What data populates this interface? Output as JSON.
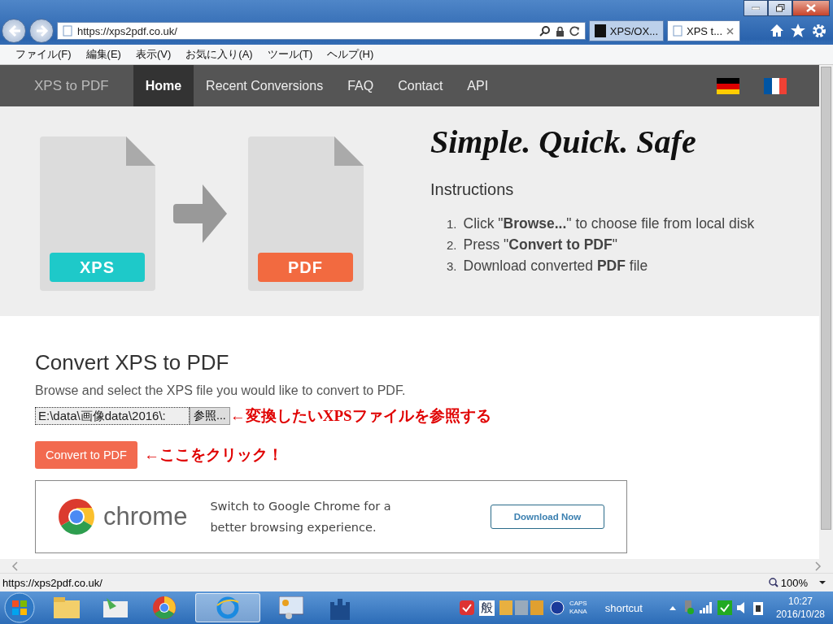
{
  "browser": {
    "address": "https://xps2pdf.co.uk/",
    "tabs": [
      {
        "label": "XPS/OX...",
        "selected": false
      },
      {
        "label": "XPS t...",
        "selected": true
      }
    ],
    "menu": [
      "ファイル(F)",
      "編集(E)",
      "表示(V)",
      "お気に入り(A)",
      "ツール(T)",
      "ヘルプ(H)"
    ]
  },
  "nav": {
    "brand": "XPS to PDF",
    "items": [
      {
        "label": "Home",
        "selected": true
      },
      {
        "label": "Recent Conversions",
        "selected": false
      },
      {
        "label": "FAQ",
        "selected": false
      },
      {
        "label": "Contact",
        "selected": false
      },
      {
        "label": "API",
        "selected": false
      }
    ]
  },
  "hero": {
    "files": [
      {
        "label": "XPS",
        "color": "#1ec9c9"
      },
      {
        "label": "PDF",
        "color": "#f26a40"
      }
    ],
    "tagline": "Simple. Quick. Safe",
    "instructions_title": "Instructions",
    "steps": [
      {
        "number": "1.",
        "text": "Click \"**Browse...**\" to choose file from local disk"
      },
      {
        "number": "2.",
        "text": "Press \"**Convert to PDF**\""
      },
      {
        "number": "3.",
        "text": "Download converted **PDF** file"
      }
    ]
  },
  "converter": {
    "title": "Convert XPS to PDF",
    "description": "Browse and select the XPS file you would like to convert to PDF.",
    "file_value": "E:\\data\\画像data\\2016\\:",
    "browse_label": "参照...",
    "browse_note": "←変換したいXPSファイルを参照する",
    "convert_button": "Convert to PDF",
    "convert_note": "←ここをクリック！"
  },
  "ad": {
    "brand": "chrome",
    "text": "Switch to Google Chrome for a better browsing experience.",
    "button": "Download Now"
  },
  "status_bar": {
    "url": "https://xps2pdf.co.uk/",
    "zoom": "100%"
  },
  "taskbar": {
    "ime": "般",
    "caps": "CAPS",
    "kana": "KANA",
    "toolbar": "shortcut",
    "time": "10:27",
    "date": "2016/10/28"
  }
}
